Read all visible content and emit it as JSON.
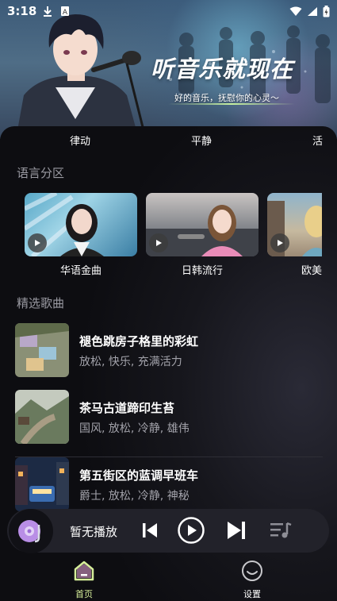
{
  "status_bar": {
    "time": "3:18"
  },
  "hero": {
    "title": "听音乐就现在",
    "subtitle": "好的音乐，抚慰你的心灵～"
  },
  "mood_tabs": [
    "律动",
    "平静",
    "活"
  ],
  "language_section": {
    "title": "语言分区",
    "items": [
      {
        "label": "华语金曲"
      },
      {
        "label": "日韩流行"
      },
      {
        "label": "欧美"
      }
    ]
  },
  "featured_section": {
    "title": "精选歌曲",
    "songs": [
      {
        "title": "褪色跳房子格里的彩虹",
        "tags": "放松, 快乐, 充满活力"
      },
      {
        "title": "茶马古道蹄印生苔",
        "tags": "国风, 放松, 冷静, 雄伟"
      },
      {
        "title": "第五街区的蓝调早班车",
        "tags": "爵士, 放松, 冷静, 神秘"
      }
    ]
  },
  "player": {
    "status": "暂无播放"
  },
  "bottom_nav": [
    {
      "label": "首页",
      "active": true
    },
    {
      "label": "设置",
      "active": false
    }
  ],
  "colors": {
    "accent": "#d6ee9a",
    "background": "#0c0c10",
    "muted_text": "#a2a2aa"
  }
}
